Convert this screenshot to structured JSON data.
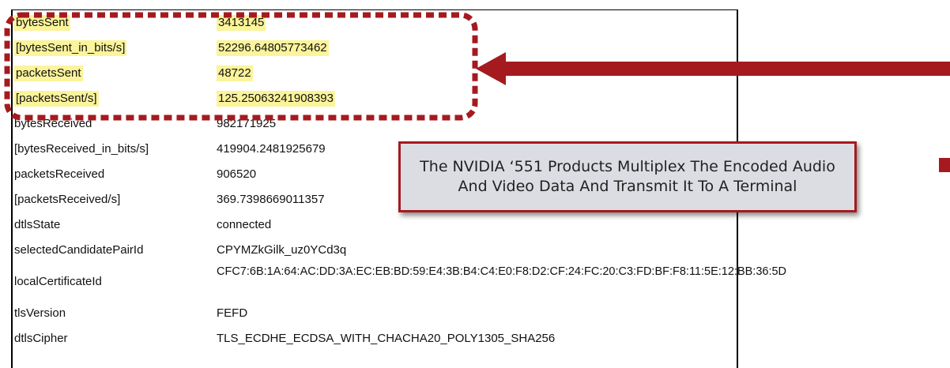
{
  "stats": {
    "rows": [
      {
        "key": "bytesSent",
        "value": "3413145"
      },
      {
        "key": "[bytesSent_in_bits/s]",
        "value": "52296.64805773462"
      },
      {
        "key": "packetsSent",
        "value": "48722"
      },
      {
        "key": "[packetsSent/s]",
        "value": "125.25063241908393"
      },
      {
        "key": "bytesReceived",
        "value": "982171925"
      },
      {
        "key": "[bytesReceived_in_bits/s]",
        "value": "419904.2481925679"
      },
      {
        "key": "packetsReceived",
        "value": "906520"
      },
      {
        "key": "[packetsReceived/s]",
        "value": "369.7398669011357"
      },
      {
        "key": "dtlsState",
        "value": "connected"
      },
      {
        "key": "selectedCandidatePairId",
        "value": "CPYMZkGilk_uz0YCd3q"
      },
      {
        "key": "localCertificateId",
        "value": "CFC7:6B:1A:64:AC:DD:3A:EC:EB:BD:59:E4:3B:B4:C4:E0:F8:D2:CF:24:FC:20:C3:FD:BF:F8:11:5E:12:BB:36:5D"
      },
      {
        "key": "tlsVersion",
        "value": "FEFD"
      },
      {
        "key": "dtlsCipher",
        "value": "TLS_ECDHE_ECDSA_WITH_CHACHA20_POLY1305_SHA256"
      }
    ]
  },
  "callout": {
    "text": "The NVIDIA ‘551 Products Multiplex The Encoded Audio And Video Data And Transmit It To A Terminal"
  },
  "colors": {
    "highlight": "#fbf49a",
    "annotation_red": "#a51a1f",
    "callout_fill": "#dcdde3"
  }
}
